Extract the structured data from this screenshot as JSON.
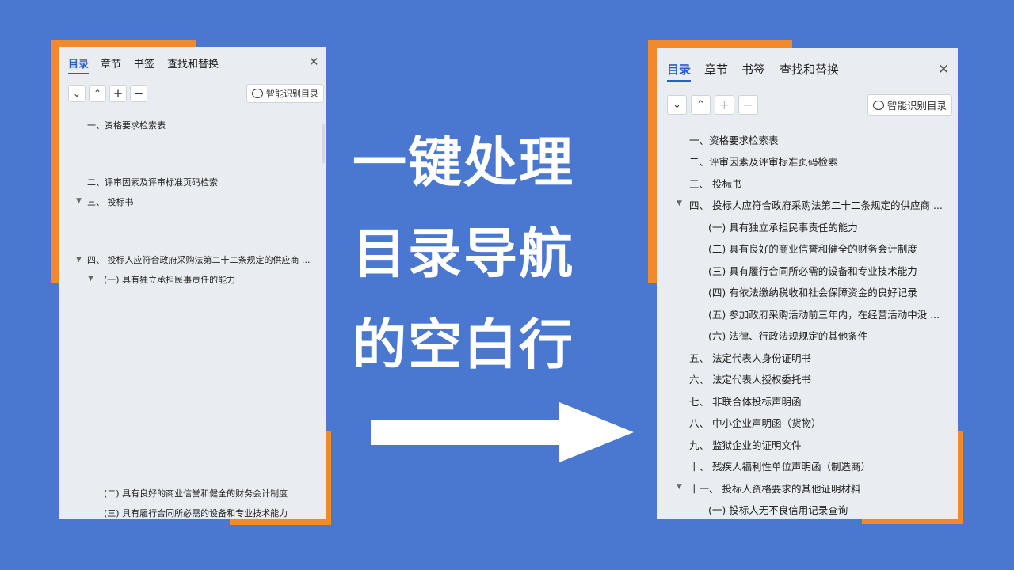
{
  "colors": {
    "background": "#4a78d0",
    "accent_orange": "#f08a2c",
    "panel": "#e9edf2",
    "active_tab": "#2b5fc7",
    "headline": "#ffffff"
  },
  "headline": {
    "line1": "一键处理",
    "line2": "目录导航",
    "line3": "的空白行"
  },
  "left_panel": {
    "tabs": [
      "目录",
      "章节",
      "书签",
      "查找和替换"
    ],
    "close_icon": "close-icon",
    "toolbar": {
      "collapse": "⌄",
      "expand": "⌃",
      "add": "+",
      "remove": "−",
      "smart_label": "智能识别目录"
    },
    "items": [
      "一、资格要求检索表",
      "二、评审因素及评审标准页码检索",
      "三、 投标书",
      "四、 投标人应符合政府采购法第二十二条规定的供应商 ...",
      "(一) 具有独立承担民事责任的能力",
      "(二) 具有良好的商业信誉和健全的财务会计制度",
      "(三) 具有履行合同所必需的设备和专业技术能力"
    ]
  },
  "right_panel": {
    "tabs": [
      "目录",
      "章节",
      "书签",
      "查找和替换"
    ],
    "close_icon": "close-icon",
    "toolbar": {
      "collapse": "⌄",
      "expand": "⌃",
      "add": "+",
      "remove": "−",
      "smart_label": "智能识别目录"
    },
    "items": [
      "一、资格要求检索表",
      "二、评审因素及评审标准页码检索",
      "三、 投标书",
      "四、 投标人应符合政府采购法第二十二条规定的供应商 ...",
      "(一) 具有独立承担民事责任的能力",
      "(二) 具有良好的商业信誉和健全的财务会计制度",
      "(三) 具有履行合同所必需的设备和专业技术能力",
      "(四) 有依法缴纳税收和社会保障资金的良好记录",
      "(五) 参加政府采购活动前三年内，在经营活动中没 ...",
      "(六) 法律、行政法规规定的其他条件",
      "五、 法定代表人身份证明书",
      "六、 法定代表人授权委托书",
      "七、 非联合体投标声明函",
      "八、 中小企业声明函（货物）",
      "九、 监狱企业的证明文件",
      "十、 残疾人福利性单位声明函（制造商）",
      "十一、 投标人资格要求的其他证明材料",
      "(一) 投标人无不良信用记录查询"
    ]
  }
}
